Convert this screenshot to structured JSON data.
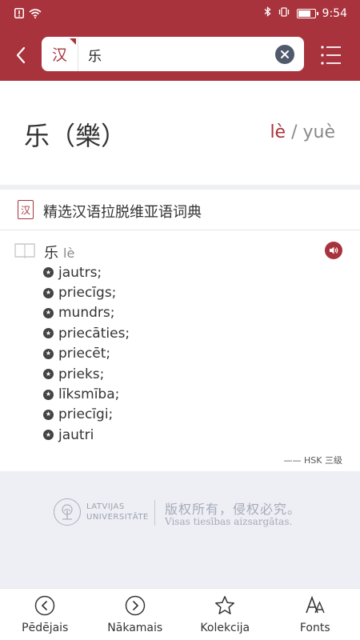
{
  "status_bar": {
    "time": "9:54"
  },
  "search": {
    "lang_label": "汉",
    "value": "乐"
  },
  "headword": {
    "simplified": "乐（樂）",
    "pinyin_1": "lè",
    "pinyin_sep": " / ",
    "pinyin_2": "yuè"
  },
  "dictionary": {
    "icon_label": "汉",
    "name": "精选汉语拉脱维亚语词典"
  },
  "entry": {
    "word": "乐",
    "pinyin": "lè",
    "senses": [
      "jautrs;",
      "priecīgs;",
      "mundrs;",
      "priecāties;",
      "priecēt;",
      "prieks;",
      "līksmība;",
      "priecīgi;",
      "jautri"
    ],
    "level_label": "—— HSK 三级"
  },
  "copyright": {
    "university_line1": "LATVIJAS",
    "university_line2": "UNIVERSITĀTE",
    "chinese": "版权所有，侵权必究。",
    "latvian": "Visas tiesības aizsargātas."
  },
  "bottom_nav": [
    {
      "label": "Pēdējais",
      "icon": "chevron-left-circle-icon"
    },
    {
      "label": "Nākamais",
      "icon": "chevron-right-circle-icon"
    },
    {
      "label": "Kolekcija",
      "icon": "star-icon"
    },
    {
      "label": "Fonts",
      "icon": "font-size-icon"
    }
  ],
  "colors": {
    "brand": "#a8333d",
    "band": "#eeeff4"
  }
}
